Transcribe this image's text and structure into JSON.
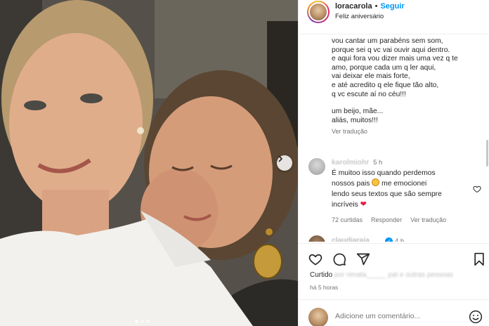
{
  "post": {
    "username": "loracarola",
    "separator": "•",
    "follow_label": "Seguir",
    "subtitle": "Feliz aniversário",
    "more_label": "···"
  },
  "caption": {
    "lines_1": [
      "vou cantar um parabéns sem som,",
      "porque sei q vc vai ouvir aqui dentro.",
      "e aqui fora vou dizer mais uma vez q te",
      "amo, porque cada um q ler aqui,",
      "vai deixar ele mais forte,",
      "e até acredito q ele fique tão alto,",
      "q vc escute aí no céu!!!"
    ],
    "lines_2": [
      "um beijo, mãe...",
      "aliás, muitos!!!"
    ],
    "translate_label": "Ver tradução"
  },
  "comments": [
    {
      "username": "karolmiohr",
      "time": "5 h",
      "line1": "É muitoo isso quando perdemos",
      "line2_pre": "nossos pais",
      "line2_post": "me emocionei",
      "line3": "lendo seus textos que são sempre",
      "line4": "incríveis",
      "likes": "72 curtidas",
      "reply_label": "Responder",
      "translate_label": "Ver tradução"
    },
    {
      "username": "claudiaraia",
      "time": "4 h"
    }
  ],
  "likes": {
    "prefix": "Curtido",
    "by": "por",
    "blurred_names": "renata_____ pat e outras pessoas"
  },
  "posted_time": "há 5 horas",
  "add_comment": {
    "placeholder": "Adicione um comentário..."
  },
  "carousel": {
    "dot_count": 3,
    "active_index": 0
  },
  "icons": {
    "like": "heart-icon",
    "comment": "comment-icon",
    "share": "share-icon",
    "save": "bookmark-icon",
    "next": "chevron-right-icon",
    "emoji": "smile-icon"
  }
}
